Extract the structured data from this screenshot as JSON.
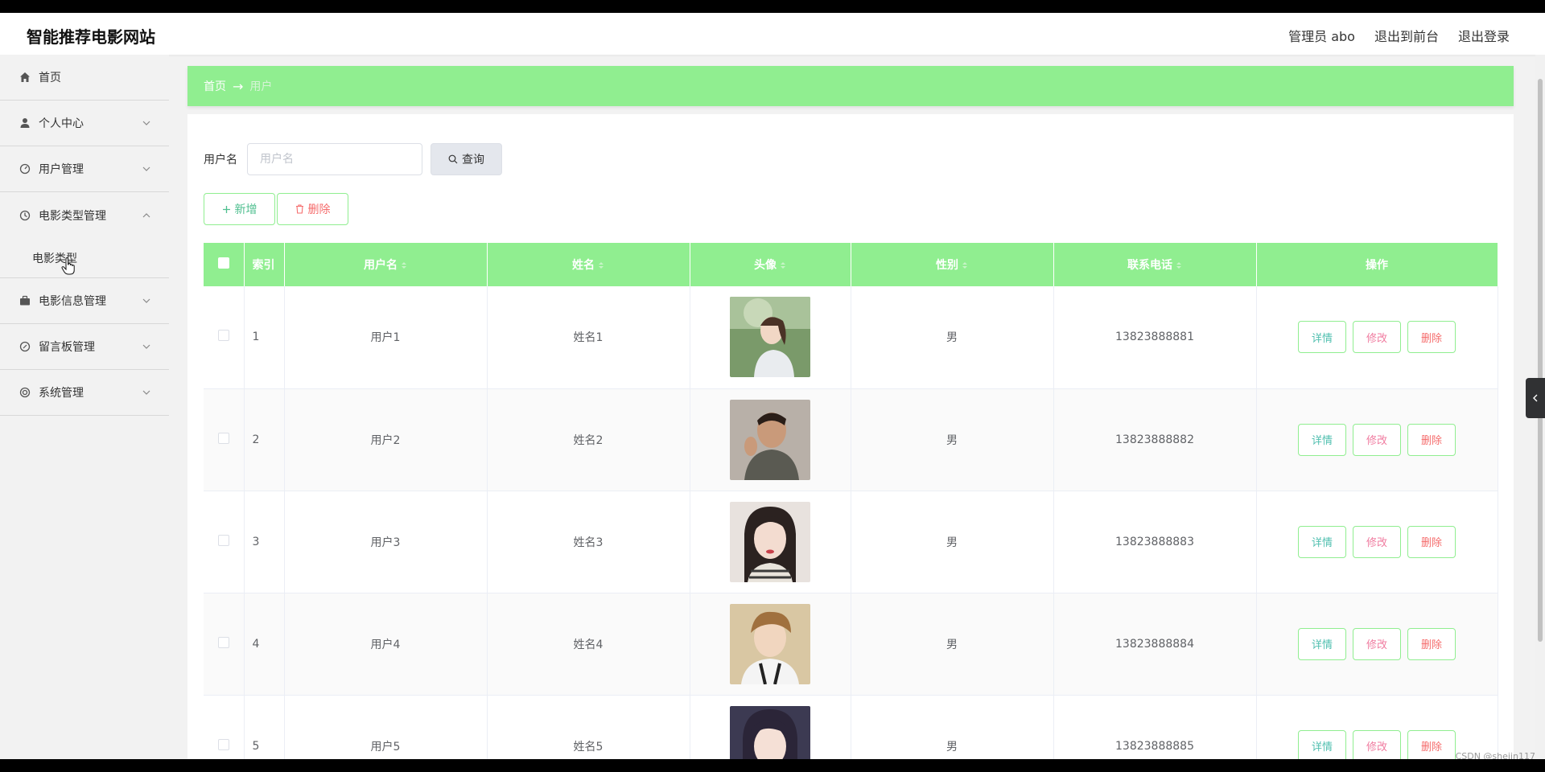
{
  "header": {
    "site_title": "智能推荐电影网站",
    "admin_label": "管理员 abo",
    "back_to_front": "退出到前台",
    "logout": "退出登录"
  },
  "sidebar": {
    "items": [
      {
        "label": "首页",
        "icon": "home-icon"
      },
      {
        "label": "个人中心",
        "icon": "user-icon"
      },
      {
        "label": "用户管理",
        "icon": "dashboard-icon"
      },
      {
        "label": "电影类型管理",
        "icon": "clock-icon"
      },
      {
        "label": "电影信息管理",
        "icon": "briefcase-icon"
      },
      {
        "label": "留言板管理",
        "icon": "compass-icon"
      },
      {
        "label": "系统管理",
        "icon": "lifebuoy-icon"
      }
    ],
    "sub_item": "电影类型"
  },
  "breadcrumb": {
    "home": "首页",
    "separator": "→",
    "current": "用户"
  },
  "search": {
    "label": "用户名",
    "placeholder": "用户名",
    "button": "查询"
  },
  "actions": {
    "add": "新增",
    "delete": "删除"
  },
  "table": {
    "headers": {
      "index": "索引",
      "username": "用户名",
      "name": "姓名",
      "avatar": "头像",
      "gender": "性别",
      "phone": "联系电话",
      "ops": "操作"
    },
    "rows": [
      {
        "index": "1",
        "username": "用户1",
        "name": "姓名1",
        "gender": "男",
        "phone": "13823888881"
      },
      {
        "index": "2",
        "username": "用户2",
        "name": "姓名2",
        "gender": "男",
        "phone": "13823888882"
      },
      {
        "index": "3",
        "username": "用户3",
        "name": "姓名3",
        "gender": "男",
        "phone": "13823888883"
      },
      {
        "index": "4",
        "username": "用户4",
        "name": "姓名4",
        "gender": "男",
        "phone": "13823888884"
      },
      {
        "index": "5",
        "username": "用户5",
        "name": "姓名5",
        "gender": "男",
        "phone": "13823888885"
      }
    ],
    "row_buttons": {
      "detail": "详情",
      "edit": "修改",
      "delete": "删除"
    }
  },
  "watermark": "CSDN @shejin117",
  "colors": {
    "accent_green": "#90ee90",
    "danger": "#f56c6c"
  }
}
